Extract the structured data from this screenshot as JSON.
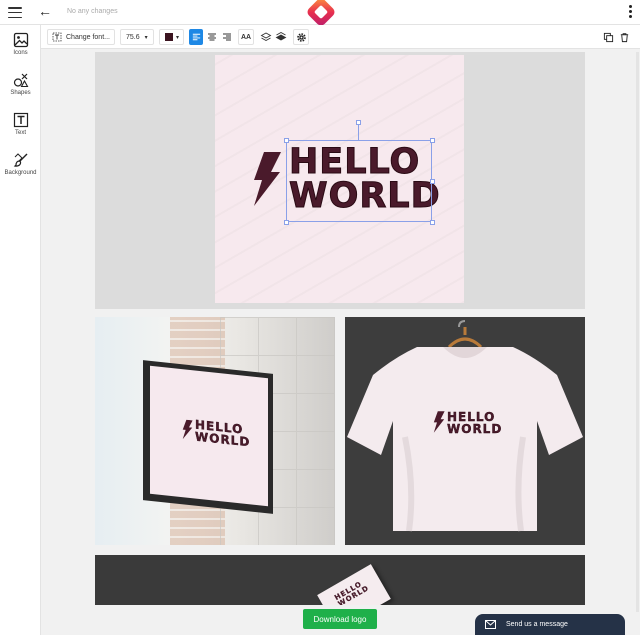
{
  "topbar": {
    "status": "No any changes",
    "icons": {
      "menu": "hamburger-icon",
      "back": "arrow-left-icon",
      "app": "app-logo",
      "more": "kebab-icon"
    }
  },
  "sidebar": {
    "items": [
      {
        "label": "Icons",
        "icon": "image-icon"
      },
      {
        "label": "Shapes",
        "icon": "shapes-icon"
      },
      {
        "label": "Text",
        "icon": "text-icon"
      },
      {
        "label": "Background",
        "icon": "paint-brush-icon"
      }
    ]
  },
  "toolbar": {
    "change_font": "Change font...",
    "font_size": "75.6",
    "text_color": "#3b1420",
    "case_label": "AA",
    "align": [
      "left",
      "center",
      "right"
    ],
    "active_align": "left",
    "accent": "#1e88e5"
  },
  "design": {
    "line1": "HELLO",
    "line2": "WORLD",
    "text_color": "#4a1a2b",
    "background": "#f7e9ee"
  },
  "actions": {
    "download": "Download logo",
    "download_color": "#1fb04a",
    "chat": "Send us a message"
  }
}
